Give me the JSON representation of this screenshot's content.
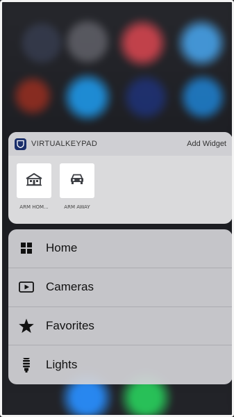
{
  "widget": {
    "app_name": "VIRTUALKEYPAD",
    "add_widget_label": "Add Widget",
    "tiles": [
      {
        "label": "ARM HOM...",
        "icon": "house-icon"
      },
      {
        "label": "ARM AWAY",
        "icon": "car-icon"
      }
    ]
  },
  "menu": {
    "items": [
      {
        "label": "Home",
        "icon": "grid-icon"
      },
      {
        "label": "Cameras",
        "icon": "play-icon"
      },
      {
        "label": "Favorites",
        "icon": "star-icon"
      },
      {
        "label": "Lights",
        "icon": "bulb-icon"
      }
    ]
  },
  "colors": {
    "app_icon": "#1b2f6b",
    "tile_icon": "#3d3f44",
    "menu_icon": "#111111"
  }
}
